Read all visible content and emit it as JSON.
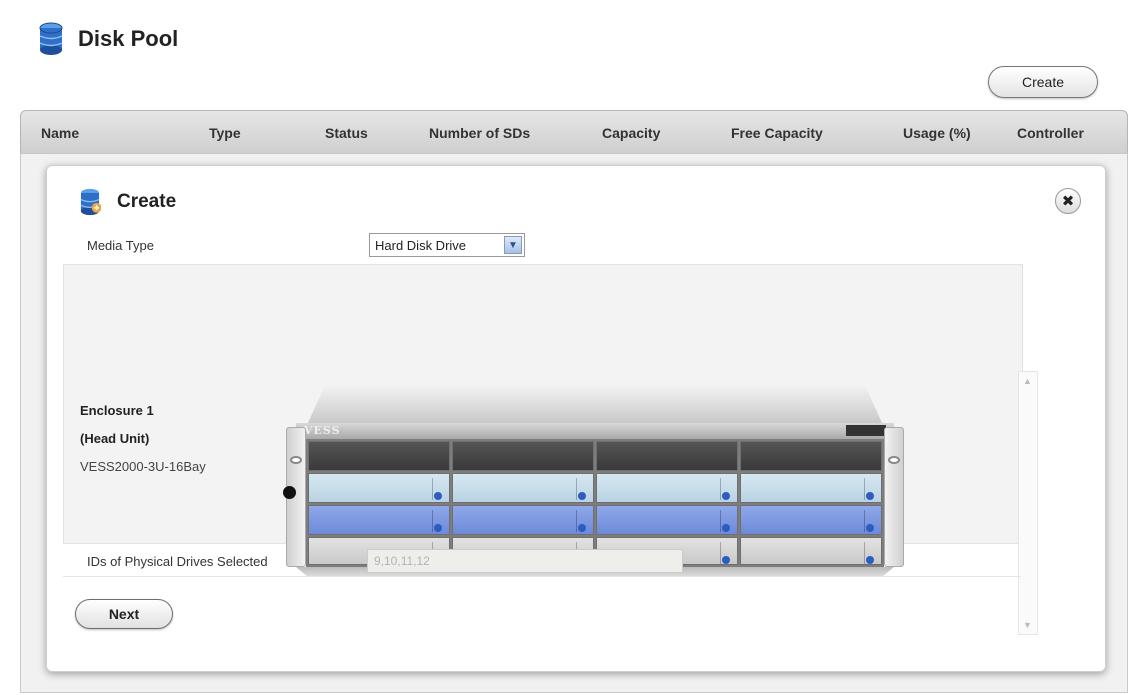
{
  "page": {
    "title": "Disk Pool",
    "title_icon": "database-icon",
    "create_button": "Create"
  },
  "table": {
    "columns": [
      "Name",
      "Type",
      "Status",
      "Number of SDs",
      "Capacity",
      "Free Capacity",
      "Usage (%)",
      "Controller"
    ]
  },
  "dialog": {
    "title": "Create",
    "title_icon": "database-icon",
    "close_icon": "close-icon",
    "media_type_label": "Media Type",
    "media_type_value": "Hard Disk Drive",
    "enclosure": {
      "name": "Enclosure 1",
      "role": "(Head Unit)",
      "model": "VESS2000-3U-16Bay",
      "brand": "VESS"
    },
    "ids_label": "IDs of Physical Drives Selected",
    "ids_value": "9,10,11,12",
    "next_button": "Next"
  },
  "colors": {
    "accent_blue": "#2b5cc0",
    "selected_drive": "#8fa8ea",
    "header_grey": "#d9d9d9"
  }
}
